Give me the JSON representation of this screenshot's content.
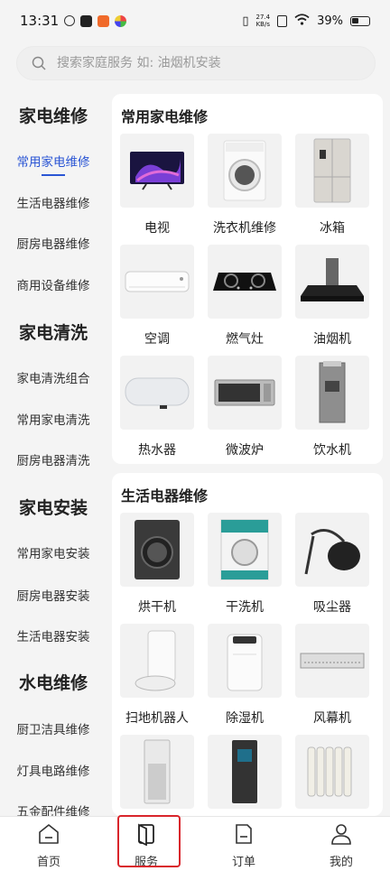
{
  "status_bar": {
    "time": "13:31",
    "net_speed_value": "27.4",
    "net_speed_unit": "KB/s",
    "battery": "39%"
  },
  "search": {
    "placeholder": "搜索家庭服务 如: 油烟机安装"
  },
  "sidebar": {
    "sections": [
      {
        "title": "家电维修",
        "items": [
          "常用家电维修",
          "生活电器维修",
          "厨房电器维修",
          "商用设备维修"
        ]
      },
      {
        "title": "家电清洗",
        "items": [
          "家电清洗组合",
          "常用家电清洗",
          "厨房电器清洗"
        ]
      },
      {
        "title": "家电安装",
        "items": [
          "常用家电安装",
          "厨房电器安装",
          "生活电器安装"
        ]
      },
      {
        "title": "水电维修",
        "items": [
          "厨卫洁具维修",
          "灯具电路维修",
          "五金配件维修"
        ]
      }
    ]
  },
  "main": {
    "card1": {
      "title": "常用家电维修",
      "items": [
        {
          "label": "电视",
          "icon": "tv-image"
        },
        {
          "label": "洗衣机维修",
          "icon": "washing-machine-image"
        },
        {
          "label": "冰箱",
          "icon": "refrigerator-image"
        },
        {
          "label": "空调",
          "icon": "air-conditioner-image"
        },
        {
          "label": "燃气灶",
          "icon": "gas-stove-image"
        },
        {
          "label": "油烟机",
          "icon": "range-hood-image"
        },
        {
          "label": "热水器",
          "icon": "water-heater-image"
        },
        {
          "label": "微波炉",
          "icon": "microwave-image"
        },
        {
          "label": "饮水机",
          "icon": "water-dispenser-image"
        }
      ]
    },
    "card2": {
      "title": "生活电器维修",
      "items": [
        {
          "label": "烘干机",
          "icon": "dryer-image"
        },
        {
          "label": "干洗机",
          "icon": "dry-cleaning-machine-image"
        },
        {
          "label": "吸尘器",
          "icon": "vacuum-cleaner-image"
        },
        {
          "label": "扫地机器人",
          "icon": "robot-vacuum-image"
        },
        {
          "label": "除湿机",
          "icon": "dehumidifier-image"
        },
        {
          "label": "风幕机",
          "icon": "air-curtain-image"
        },
        {
          "label": "",
          "icon": "air-purifier-image"
        },
        {
          "label": "",
          "icon": "water-purifier-image"
        },
        {
          "label": "",
          "icon": "oil-heater-image"
        }
      ]
    }
  },
  "tabbar": {
    "home": "首页",
    "service": "服务",
    "orders": "订单",
    "mine": "我的"
  },
  "colors": {
    "accent": "#2a55d4",
    "highlight": "#d9252b"
  }
}
